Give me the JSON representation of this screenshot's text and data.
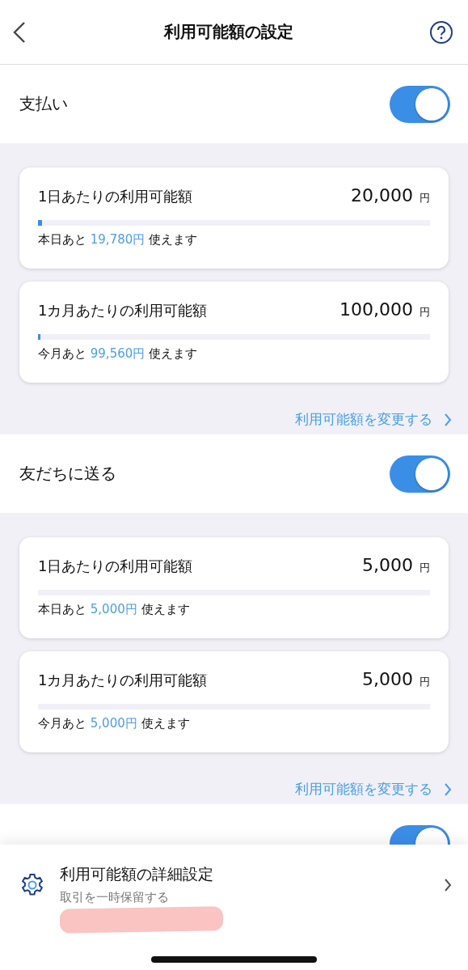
{
  "header": {
    "title": "利用可能額の設定"
  },
  "sections": [
    {
      "title": "支払い",
      "on": true,
      "limits": [
        {
          "label": "1日あたりの利用可能額",
          "amount": "20,000",
          "unit": "円",
          "level": 0.011,
          "prefix": "本日あと",
          "remaining": "19,780円",
          "suffix": "使えます"
        },
        {
          "label": "1カ月あたりの利用可能額",
          "amount": "100,000",
          "unit": "円",
          "level": 0.0044,
          "prefix": "今月あと",
          "remaining": "99,560円",
          "suffix": "使えます"
        }
      ],
      "link": "利用可能額を変更する"
    },
    {
      "title": "友だちに送る",
      "on": true,
      "limits": [
        {
          "label": "1日あたりの利用可能額",
          "amount": "5,000",
          "unit": "円",
          "level": 0,
          "prefix": "本日あと",
          "remaining": "5,000円",
          "suffix": "使えます"
        },
        {
          "label": "1カ月あたりの利用可能額",
          "amount": "5,000",
          "unit": "円",
          "level": 0,
          "prefix": "今月あと",
          "remaining": "5,000円",
          "suffix": "使えます"
        }
      ],
      "link": "利用可能額を変更する"
    },
    {
      "on": true
    }
  ],
  "bottom_sheet": {
    "title": "利用可能額の詳細設定",
    "subtitle": "取引を一時保留する"
  }
}
